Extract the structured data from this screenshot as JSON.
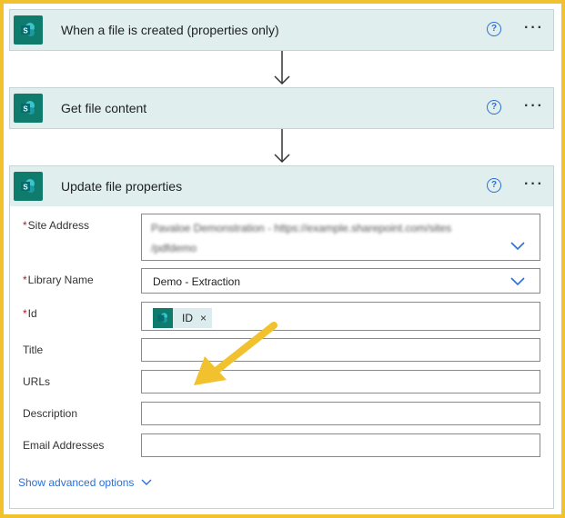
{
  "steps": [
    {
      "title": "When a file is created (properties only)"
    },
    {
      "title": "Get file content"
    },
    {
      "title": "Update file properties"
    }
  ],
  "help_glyph": "?",
  "more_glyph": "···",
  "icon_letter": "S",
  "form": {
    "site_address": {
      "label": "Site Address",
      "required_mark": "*",
      "line1": "Pavaloe Demonstration - https://example.sharepoint.com/sites",
      "line2": "/pdfdemo"
    },
    "library_name": {
      "label": "Library Name",
      "required_mark": "*",
      "value": "Demo - Extraction"
    },
    "id": {
      "label": "Id",
      "required_mark": "*",
      "token": "ID",
      "token_remove": "×"
    },
    "title": {
      "label": "Title",
      "value": ""
    },
    "urls": {
      "label": "URLs",
      "value": ""
    },
    "description": {
      "label": "Description",
      "value": ""
    },
    "email_addresses": {
      "label": "Email Addresses",
      "value": ""
    }
  },
  "show_advanced": "Show advanced options",
  "colors": {
    "frame": "#f2c12e",
    "header": "#e0eeee",
    "sharepoint": "#0f7b6c",
    "accent": "#2b6fd6",
    "annotation_arrow": "#f2c12e"
  }
}
